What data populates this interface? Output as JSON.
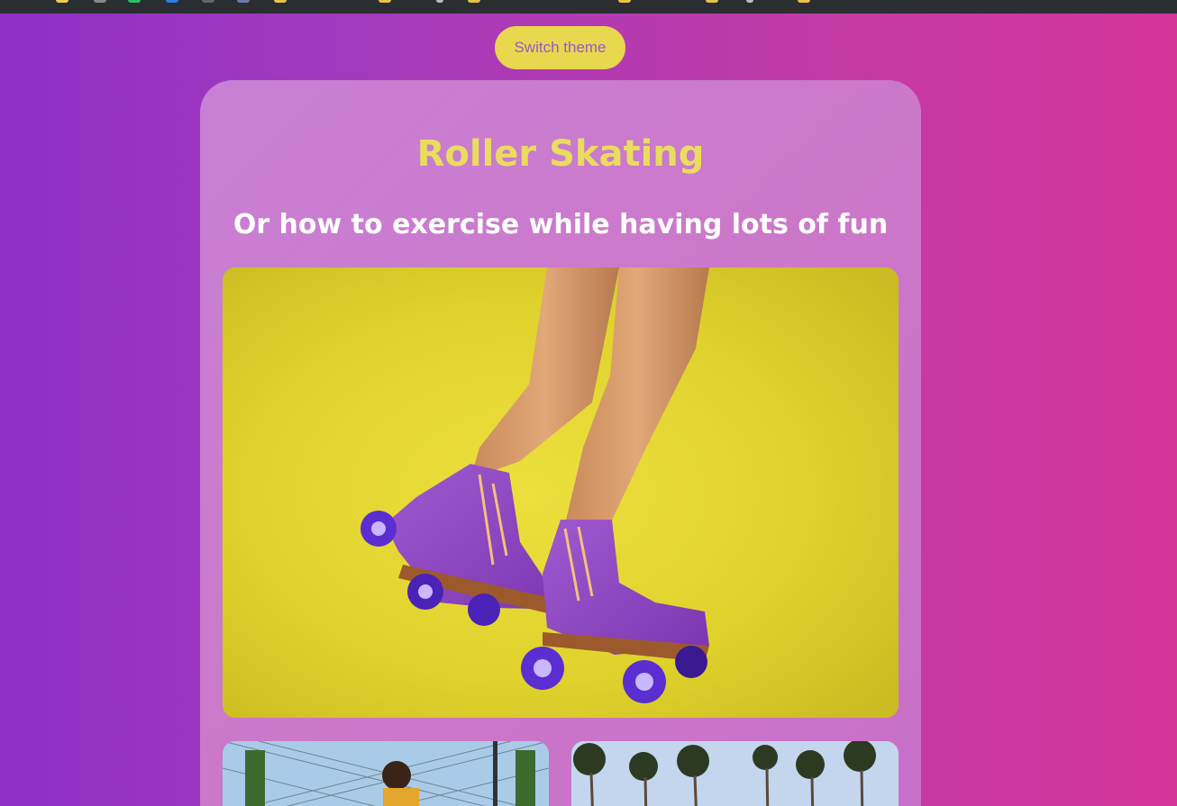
{
  "switch_theme": {
    "label": "Switch theme"
  },
  "hero": {
    "title": "Roller Skating",
    "subtitle": "Or how to exercise while having lots of fun"
  },
  "images": {
    "main": "roller-skates-photo",
    "left": "skater-by-fence-photo",
    "right": "palm-trees-photo"
  },
  "colors": {
    "title": "#e9dc5e",
    "button_bg": "#e8d84e",
    "button_text": "#9a58c6",
    "background_start": "#8f2fc7",
    "background_end": "#d5349a"
  }
}
